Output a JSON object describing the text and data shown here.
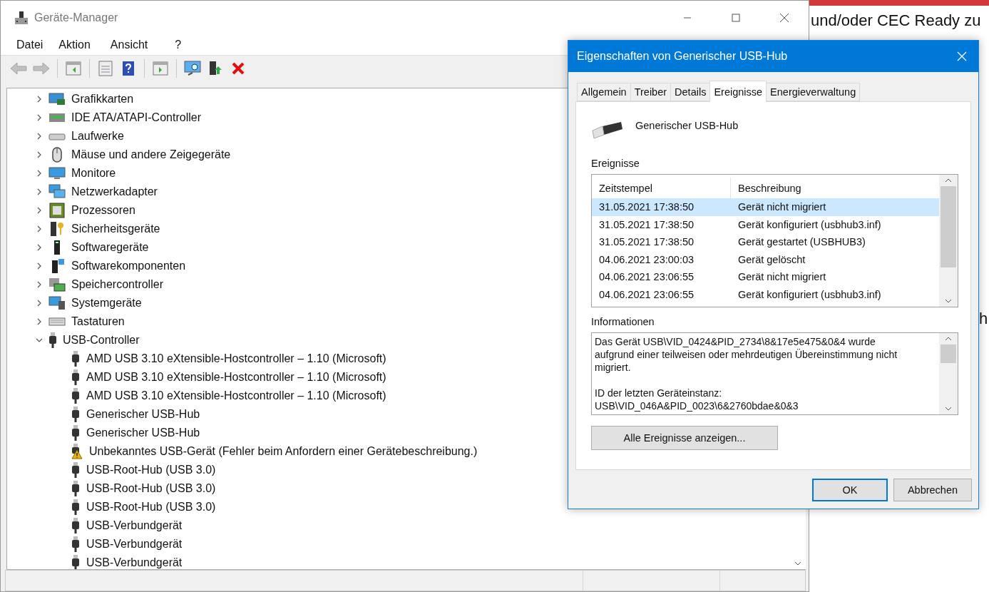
{
  "background_page": {
    "texts": [
      "und/oder CEC Ready zu",
      "h"
    ]
  },
  "device_manager": {
    "title": "Geräte-Manager",
    "menu": [
      "Datei",
      "Aktion",
      "Ansicht",
      "?"
    ],
    "toolbar": [
      {
        "kind": "back",
        "disabled": true
      },
      {
        "kind": "forward",
        "disabled": true
      },
      {
        "kind": "tree",
        "disabled": false
      },
      {
        "kind": "properties",
        "disabled": false
      },
      {
        "kind": "help",
        "disabled": false
      },
      {
        "kind": "pane",
        "disabled": false
      },
      {
        "kind": "scan",
        "disabled": false
      },
      {
        "kind": "driver",
        "disabled": false
      },
      {
        "kind": "remove",
        "disabled": false
      }
    ],
    "tree": [
      {
        "label": "Grafikkarten",
        "kind": "display",
        "expanded": false
      },
      {
        "label": "IDE ATA/ATAPI-Controller",
        "kind": "controller",
        "expanded": false
      },
      {
        "label": "Laufwerke",
        "kind": "drive",
        "expanded": false
      },
      {
        "label": "Mäuse und andere Zeigegeräte",
        "kind": "mouse",
        "expanded": false
      },
      {
        "label": "Monitore",
        "kind": "monitor",
        "expanded": false
      },
      {
        "label": "Netzwerkadapter",
        "kind": "network",
        "expanded": false
      },
      {
        "label": "Prozessoren",
        "kind": "cpu",
        "expanded": false
      },
      {
        "label": "Sicherheitsgeräte",
        "kind": "security",
        "expanded": false
      },
      {
        "label": "Softwaregeräte",
        "kind": "software",
        "expanded": false
      },
      {
        "label": "Softwarekomponenten",
        "kind": "component",
        "expanded": false
      },
      {
        "label": "Speichercontroller",
        "kind": "storage",
        "expanded": false
      },
      {
        "label": "Systemgeräte",
        "kind": "system",
        "expanded": false
      },
      {
        "label": "Tastaturen",
        "kind": "keyboard",
        "expanded": false
      },
      {
        "label": "USB-Controller",
        "kind": "usb",
        "expanded": true,
        "children": [
          {
            "label": "AMD USB 3.10 eXtensible-Hostcontroller – 1.10 (Microsoft)",
            "warning": false
          },
          {
            "label": "AMD USB 3.10 eXtensible-Hostcontroller – 1.10 (Microsoft)",
            "warning": false
          },
          {
            "label": "AMD USB 3.10 eXtensible-Hostcontroller – 1.10 (Microsoft)",
            "warning": false
          },
          {
            "label": "Generischer USB-Hub",
            "warning": false
          },
          {
            "label": "Generischer USB-Hub",
            "warning": false
          },
          {
            "label": "Unbekanntes USB-Gerät (Fehler beim Anfordern einer Gerätebeschreibung.)",
            "warning": true
          },
          {
            "label": "USB-Root-Hub (USB 3.0)",
            "warning": false
          },
          {
            "label": "USB-Root-Hub (USB 3.0)",
            "warning": false
          },
          {
            "label": "USB-Root-Hub (USB 3.0)",
            "warning": false
          },
          {
            "label": "USB-Verbundgerät",
            "warning": false
          },
          {
            "label": "USB-Verbundgerät",
            "warning": false
          },
          {
            "label": "USB-Verbundgerät",
            "warning": false
          }
        ]
      }
    ]
  },
  "dialog": {
    "title": "Eigenschaften von Generischer USB-Hub",
    "tabs": [
      {
        "label": "Allgemein",
        "selected": false
      },
      {
        "label": "Treiber",
        "selected": false
      },
      {
        "label": "Details",
        "selected": false
      },
      {
        "label": "Ereignisse",
        "selected": true
      },
      {
        "label": "Energieverwaltung",
        "selected": false
      }
    ],
    "device_name": "Generischer USB-Hub",
    "events_label": "Ereignisse",
    "events_columns": [
      "Zeitstempel",
      "Beschreibung"
    ],
    "events": [
      {
        "timestamp": "31.05.2021 17:38:50",
        "description": "Gerät nicht migriert",
        "selected": true
      },
      {
        "timestamp": "31.05.2021 17:38:50",
        "description": "Gerät konfiguriert (usbhub3.inf)",
        "selected": false
      },
      {
        "timestamp": "31.05.2021 17:38:50",
        "description": "Gerät gestartet (USBHUB3)",
        "selected": false
      },
      {
        "timestamp": "04.06.2021 23:00:03",
        "description": "Gerät gelöscht",
        "selected": false
      },
      {
        "timestamp": "04.06.2021 23:06:55",
        "description": "Gerät nicht migriert",
        "selected": false
      },
      {
        "timestamp": "04.06.2021 23:06:55",
        "description": "Gerät konfiguriert (usbhub3.inf)",
        "selected": false
      }
    ],
    "info_label": "Informationen",
    "info_paragraphs": [
      "Das Gerät USB\\VID_0424&PID_2734\\8&17e5e475&0&4 wurde aufgrund einer teilweisen oder mehrdeutigen Übereinstimmung nicht migriert.",
      "ID der letzten Geräteinstanz: USB\\VID_046A&PID_0023\\6&2760bdae&0&3"
    ],
    "show_all_button": "Alle Ereignisse anzeigen...",
    "buttons": [
      {
        "label": "OK",
        "default": true
      },
      {
        "label": "Abbrechen",
        "default": false
      }
    ]
  }
}
